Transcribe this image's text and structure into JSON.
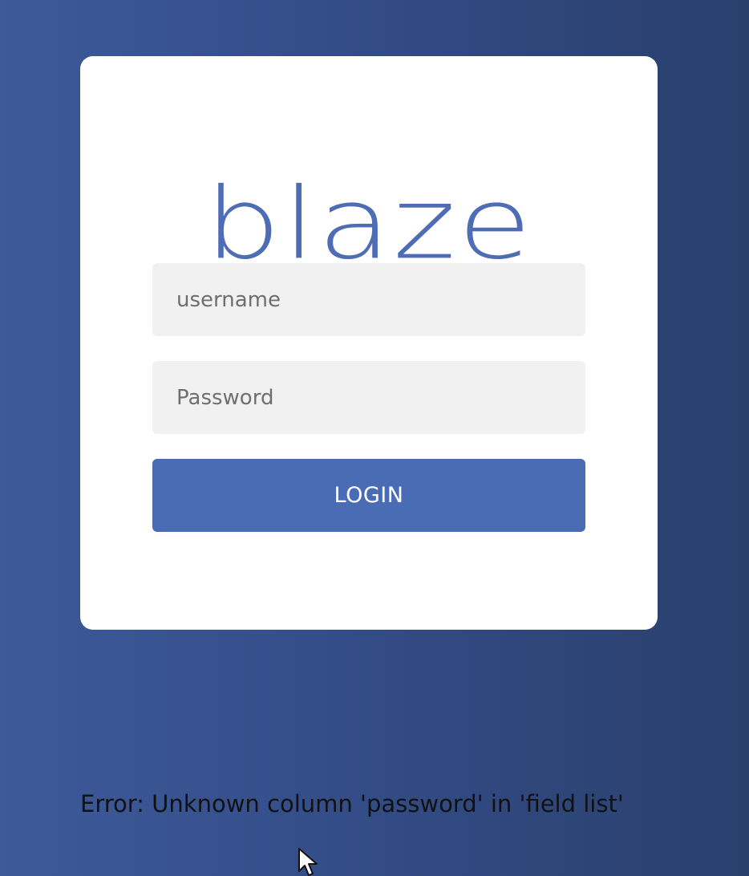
{
  "login": {
    "logo_text": "blaze",
    "username_placeholder": "username",
    "password_placeholder": "Password",
    "login_button_label": "LOGIN"
  },
  "error": {
    "message": "Error: Unknown column 'password' in 'field list'"
  },
  "colors": {
    "background_start": "#3d5a99",
    "background_end": "#2a3f6c",
    "card": "#ffffff",
    "accent": "#4a6cb5",
    "field_bg": "#f1f1f1"
  },
  "icons": {
    "pointer": "mouse-pointer-icon"
  }
}
